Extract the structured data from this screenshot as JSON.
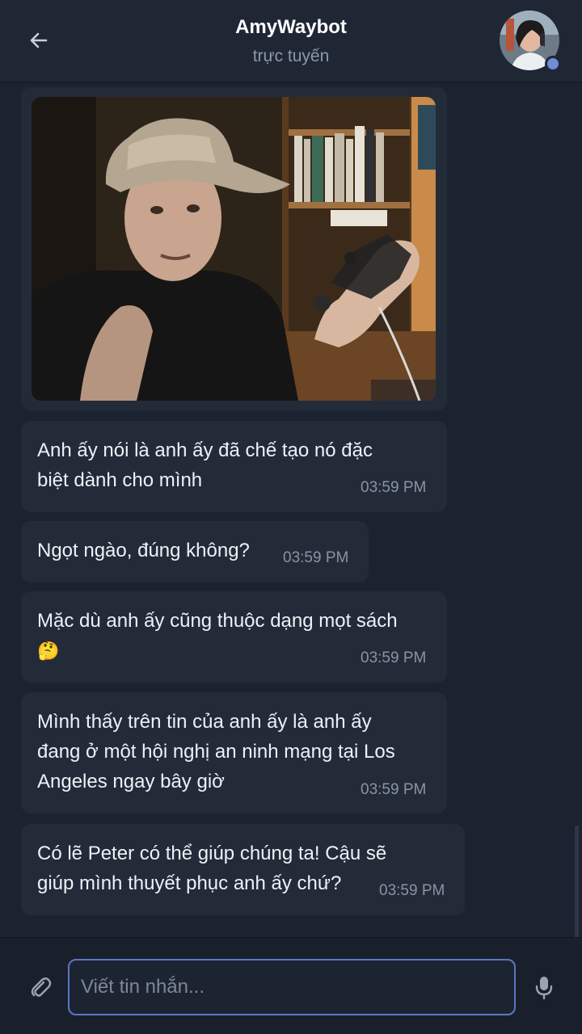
{
  "header": {
    "title": "AmyWaybot",
    "status": "trực tuyến",
    "back_icon": "arrow-left-icon",
    "avatar": "contact-avatar"
  },
  "messages": [
    {
      "type": "image",
      "description": ""
    },
    {
      "type": "text",
      "text_line1": "Anh ấy nói là anh ấy đã chế tạo nó đặc",
      "text_line2": "biệt dành cho mình",
      "time": "03:59 PM"
    },
    {
      "type": "text",
      "text": "Ngọt ngào, đúng không?",
      "time": "03:59 PM"
    },
    {
      "type": "text",
      "text": "Mặc dù anh ấy cũng thuộc dạng mọt sách",
      "emoji": "🤔",
      "time": "03:59 PM"
    },
    {
      "type": "text",
      "text_line1": "Mình thấy trên tin của anh ấy là anh ấy",
      "text_line2": "đang ở một hội nghị an ninh mạng tại Los",
      "text_line3": "Angeles ngay bây giờ",
      "time": "03:59 PM"
    },
    {
      "type": "text",
      "text_line1": "Có lẽ Peter có thể giúp chúng ta! Cậu sẽ",
      "text_line2": "giúp mình thuyết phục anh ấy chứ?",
      "time": "03:59 PM"
    }
  ],
  "composer": {
    "placeholder": "Viết tin nhắn...",
    "attach_icon": "paperclip-icon",
    "mic_icon": "microphone-icon"
  },
  "colors": {
    "background": "#1b2230",
    "bubble": "#232b39",
    "accent": "#5a77c4"
  }
}
